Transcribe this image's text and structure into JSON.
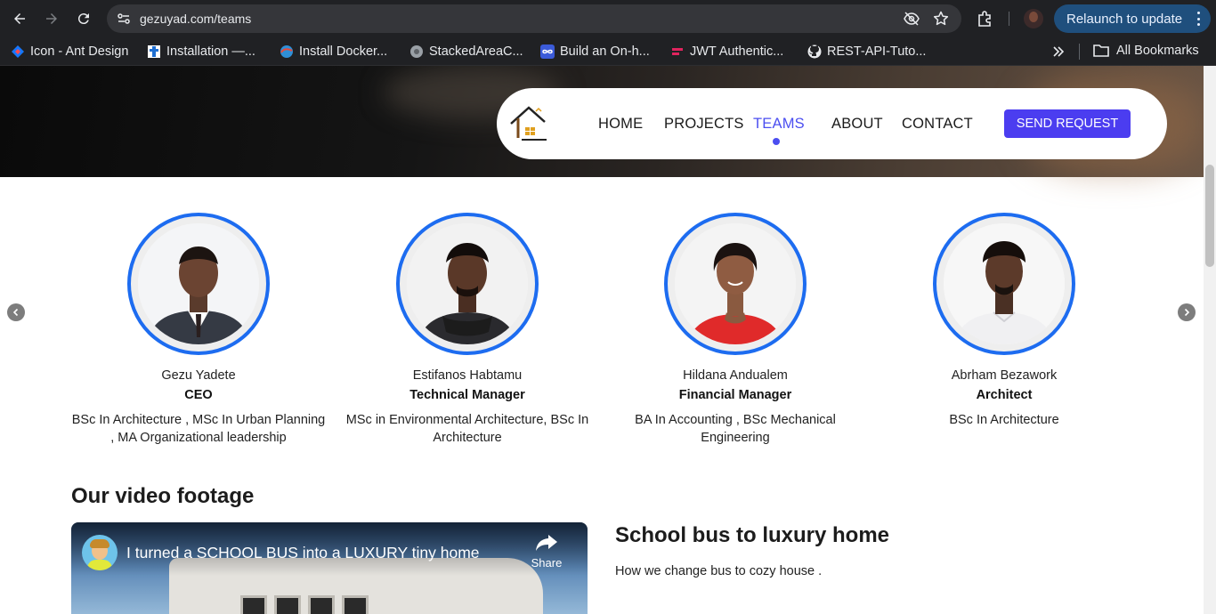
{
  "browser": {
    "url": "gezuyad.com/teams",
    "relaunch_label": "Relaunch to update",
    "nav_icons": [
      "back-icon",
      "forward-icon",
      "reload-icon"
    ],
    "omnibox_icons": [
      "site-info-icon",
      "eye-off-icon",
      "star-icon"
    ],
    "bookmarks": [
      {
        "label": "Icon - Ant Design",
        "icon": "ant-design-icon"
      },
      {
        "label": "Installation —...",
        "icon": "bookmark-page-icon"
      },
      {
        "label": "Install Docker...",
        "icon": "docker-icon"
      },
      {
        "label": "StackedAreaC...",
        "icon": "globe-icon"
      },
      {
        "label": "Build an On-h...",
        "icon": "infinity-icon"
      },
      {
        "label": "JWT Authentic...",
        "icon": "jwt-icon"
      },
      {
        "label": "REST-API-Tuto...",
        "icon": "github-icon"
      }
    ],
    "all_bookmarks_label": "All Bookmarks"
  },
  "navbar": {
    "links": [
      "HOME",
      "PROJECTS",
      "TEAMS",
      "ABOUT",
      "CONTACT"
    ],
    "active": "TEAMS",
    "cta_label": "SEND REQUEST"
  },
  "team": [
    {
      "name": "Gezu Yadete",
      "role": "CEO",
      "degree": "BSc In Architecture , MSc In Urban Planning , MA Organizational leadership"
    },
    {
      "name": "Estifanos Habtamu",
      "role": "Technical Manager",
      "degree": "MSc in Environmental Architecture, BSc In Architecture"
    },
    {
      "name": "Hildana Andualem",
      "role": "Financial Manager",
      "degree": "BA In Accounting , BSc Mechanical Engineering"
    },
    {
      "name": "Abrham Bezawork",
      "role": "Architect",
      "degree": "BSc In Architecture"
    }
  ],
  "video_section": {
    "title": "Our video footage",
    "embed_title": "I turned a SCHOOL BUS into a LUXURY tiny home",
    "share_label": "Share",
    "heading": "School bus to luxury home",
    "description": "How we change bus to cozy house ."
  },
  "colors": {
    "accent": "#4b4ef0",
    "cta": "#4b3df0",
    "avatar_ring": "#1d6cf0",
    "chrome_bg": "#202124"
  }
}
